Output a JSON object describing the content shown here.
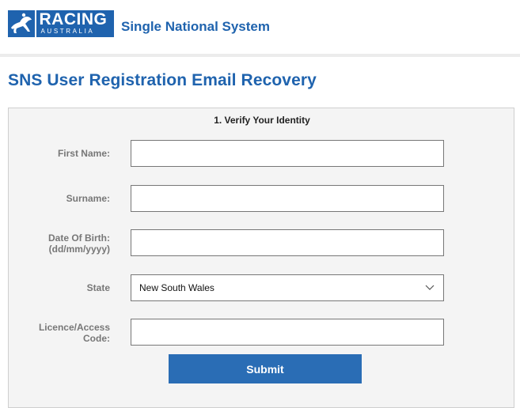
{
  "brand": {
    "logo_line1": "RACING",
    "logo_line2": "AUSTRALIA",
    "app_title": "Single National System",
    "color": "#1f63ae"
  },
  "page": {
    "title": "SNS User Registration Email Recovery"
  },
  "form": {
    "section_title": "1. Verify Your Identity",
    "first_name_label": "First Name:",
    "first_name_value": "",
    "surname_label": "Surname:",
    "surname_value": "",
    "dob_label_line1": "Date Of Birth:",
    "dob_label_line2": "(dd/mm/yyyy)",
    "dob_value": "",
    "state_label": "State",
    "state_selected": "New South Wales",
    "licence_label_line1": "Licence/Access",
    "licence_label_line2": "Code:",
    "licence_value": "",
    "submit_label": "Submit",
    "submit_color": "#2a6db5"
  },
  "icons": {
    "logo": "jockey-horse-icon",
    "select": "chevron-down-icon"
  }
}
